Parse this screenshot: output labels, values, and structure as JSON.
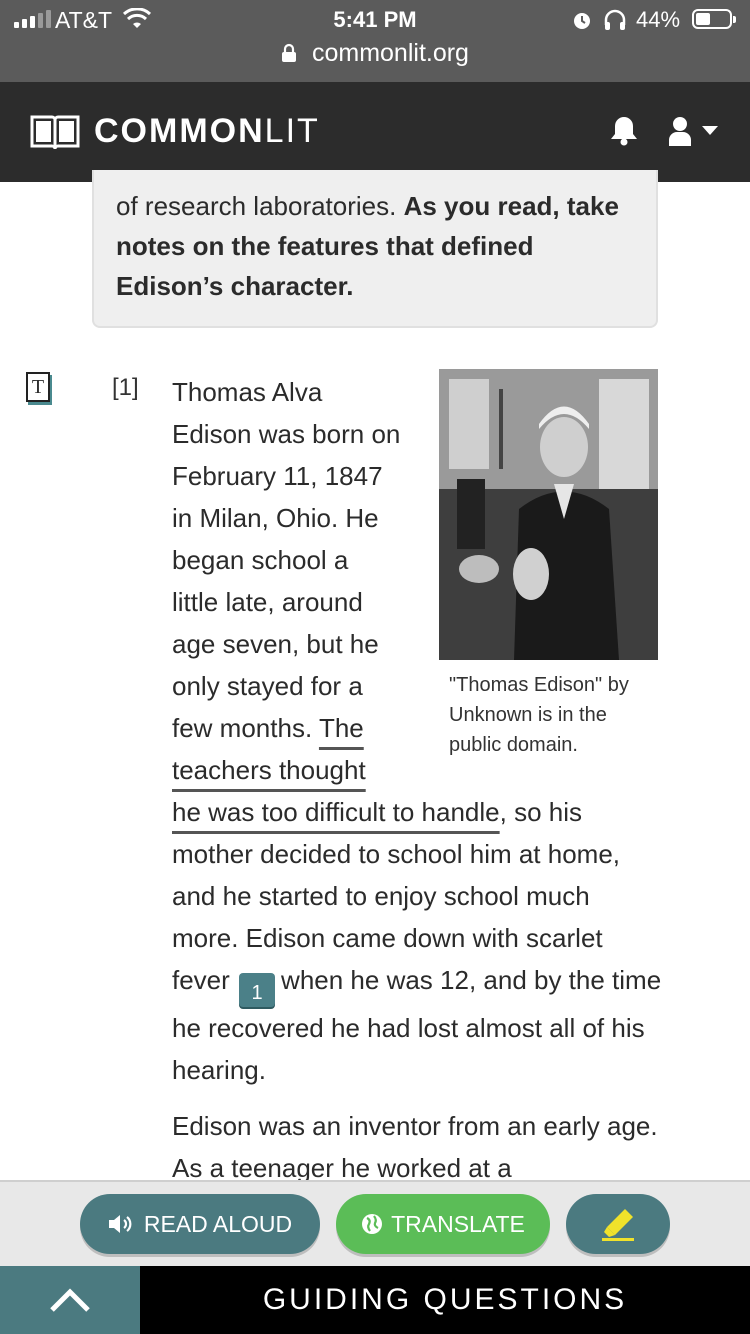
{
  "status_bar": {
    "carrier": "AT&T",
    "time": "5:41 PM",
    "battery": "44%",
    "battery_level": 0.44
  },
  "browser": {
    "url": "commonlit.org"
  },
  "header": {
    "logo_bold": "COMMON",
    "logo_light": "LIT"
  },
  "intro": {
    "line1_plain": "of research laboratories. ",
    "line1_bold": "As you read, take notes on the features that defined Edison’s character."
  },
  "article": {
    "paragraph_number": "[1]",
    "p1_lines": [
      "Thomas Alva",
      "Edison was born on",
      "February 11, 1847",
      "in Milan, Ohio. He",
      "began school a",
      "little late, around",
      "age seven, but he",
      "only stayed for a"
    ],
    "p1_line9_plain": "few months. ",
    "p1_line9_hl": "The",
    "p1_line10_hl": "teachers thought",
    "p1_wide_hl": "he was too difficult to handle",
    "p1_wide_after": ", so his mother decided to school him at home, and he started to enjoy school much more. Edison came down with scarlet fever",
    "footnote": "1",
    "p1_wide_end": "when he was 12, and by the time he recovered he had lost almost all of his hearing.",
    "p2": "Edison was an inventor from an early age. As a teenager he worked at a"
  },
  "image": {
    "caption": "\"Thomas Edison\" by Unknown is in the public domain."
  },
  "toolbar": {
    "read_aloud": "READ ALOUD",
    "translate": "TRANSLATE"
  },
  "guiding_questions": {
    "label": "GUIDING QUESTIONS"
  },
  "icons": {
    "text_toggle": "T"
  }
}
